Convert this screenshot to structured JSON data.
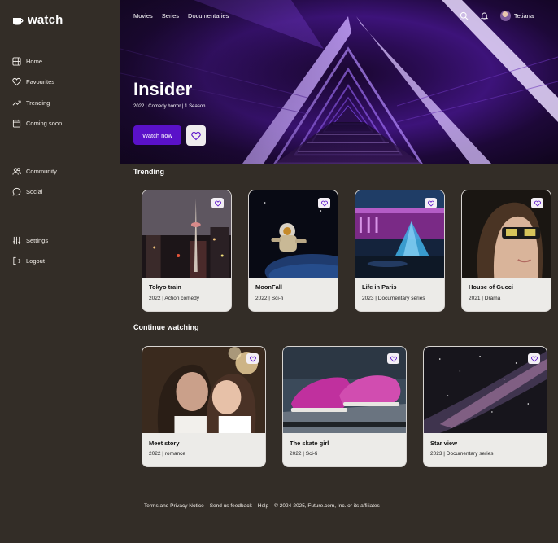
{
  "app": {
    "name": "watch"
  },
  "sidebar": {
    "items": [
      {
        "label": "Home",
        "icon": "film-icon"
      },
      {
        "label": "Favourites",
        "icon": "heart-icon"
      },
      {
        "label": "Trending",
        "icon": "trending-icon"
      },
      {
        "label": "Coming soon",
        "icon": "calendar-icon"
      },
      {
        "label": "Community",
        "icon": "users-icon"
      },
      {
        "label": "Social",
        "icon": "chat-icon"
      },
      {
        "label": "Settings",
        "icon": "sliders-icon"
      },
      {
        "label": "Logout",
        "icon": "logout-icon"
      }
    ]
  },
  "topnav": {
    "movies": "Movies",
    "series": "Series",
    "documentaries": "Documentaries"
  },
  "user": {
    "name": "Tetiana"
  },
  "hero": {
    "title": "Insider",
    "meta": "2022 | Comedy horror | 1 Season",
    "watch_label": "Watch now",
    "accent": "#5a11c9"
  },
  "trending": {
    "title": "Trending",
    "cards": [
      {
        "title": "Tokyo train",
        "meta": "2022 | Action comedy"
      },
      {
        "title": "MoonFall",
        "meta": "2022 | Sci-fi"
      },
      {
        "title": "Life in Paris",
        "meta": "2023 | Documentary series"
      },
      {
        "title": "House of Gucci",
        "meta": "2021 | Drama"
      }
    ]
  },
  "continue": {
    "title": "Continue watching",
    "cards": [
      {
        "title": "Meet story",
        "meta": "2022 | romance"
      },
      {
        "title": "The skate girl",
        "meta": "2022 | Sci-fi"
      },
      {
        "title": "Star view",
        "meta": "2023 | Documentary series"
      }
    ]
  },
  "footer": {
    "terms": "Terms and Privacy Notice",
    "feedback": "Send us feedback",
    "help": "Help",
    "copyright": "© 2024-2025, Future.com, Inc. or its affiliates"
  },
  "colors": {
    "background": "#332d27",
    "card": "#ecebe8",
    "accent": "#5a11c9"
  }
}
